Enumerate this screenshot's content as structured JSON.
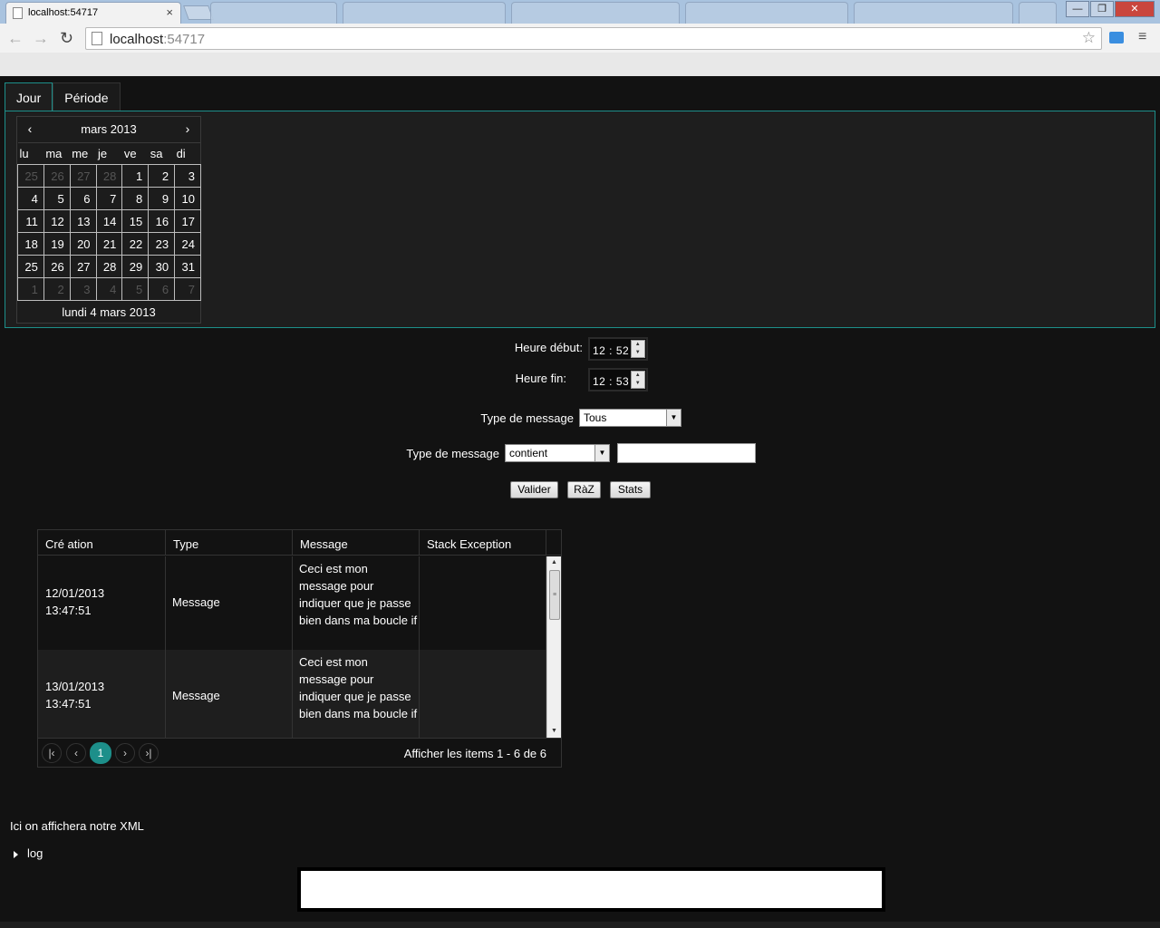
{
  "browser": {
    "tab_title": "localhost:54717",
    "tab_close": "×",
    "background_tabs": [
      "",
      "",
      "",
      "",
      "",
      ""
    ],
    "url_host": "localhost",
    "url_port": ":54717",
    "nav_back": "←",
    "nav_forward": "→",
    "nav_reload": "↻",
    "star": "☆",
    "menu": "≡",
    "win_min": "—",
    "win_max": "❐",
    "win_close": "✕"
  },
  "tabs": [
    {
      "label": "Jour",
      "active": true
    },
    {
      "label": "Période",
      "active": false
    }
  ],
  "calendar": {
    "month_label": "mars 2013",
    "prev": "‹",
    "next": "›",
    "weekdays": [
      "lu",
      "ma",
      "me",
      "je",
      "ve",
      "sa",
      "di"
    ],
    "weeks": [
      [
        "25",
        "26",
        "27",
        "28",
        "1",
        "2",
        "3"
      ],
      [
        "4",
        "5",
        "6",
        "7",
        "8",
        "9",
        "10"
      ],
      [
        "11",
        "12",
        "13",
        "14",
        "15",
        "16",
        "17"
      ],
      [
        "18",
        "19",
        "20",
        "21",
        "22",
        "23",
        "24"
      ],
      [
        "25",
        "26",
        "27",
        "28",
        "29",
        "30",
        "31"
      ],
      [
        "1",
        "2",
        "3",
        "4",
        "5",
        "6",
        "7"
      ]
    ],
    "footer": "lundi 4 mars 2013"
  },
  "filters": {
    "heure_debut_label": "Heure début:",
    "heure_debut_value": "12 : 52",
    "heure_fin_label": "Heure fin:",
    "heure_fin_value": "12 : 53",
    "type_label_1": "Type de message",
    "type_select_value": "Tous",
    "type_label_2": "Type de message",
    "match_select_value": "contient",
    "text_value": "",
    "spin_up": "▲",
    "spin_down": "▼",
    "select_arrow": "▼"
  },
  "buttons": {
    "valider": "Valider",
    "raz": "RàZ",
    "stats": "Stats"
  },
  "grid": {
    "columns": [
      "Cré ation",
      "Type",
      "Message",
      "Stack Exception"
    ],
    "rows": [
      {
        "date": "12/01/2013",
        "time": "13:47:51",
        "type": "Message",
        "message": "Ceci est mon message pour indiquer que je passe bien dans ma boucle if",
        "stack": ""
      },
      {
        "date": "13/01/2013",
        "time": "13:47:51",
        "type": "Message",
        "message": "Ceci est mon message pour indiquer que je passe bien dans ma boucle if",
        "stack": ""
      }
    ],
    "scroll_up": "▲",
    "scroll_down": "▼",
    "scroll_grip": "≡",
    "pager": {
      "first": "|‹",
      "prev": "‹",
      "current": "1",
      "next": "›",
      "last": "›|",
      "info": "Afficher les items 1 - 6 de 6"
    }
  },
  "xml_text": "Ici on affichera notre XML",
  "tree_label": "log",
  "colors": {
    "accent": "#1d8f8a",
    "background": "#121212",
    "panel": "#1e1e1e"
  }
}
